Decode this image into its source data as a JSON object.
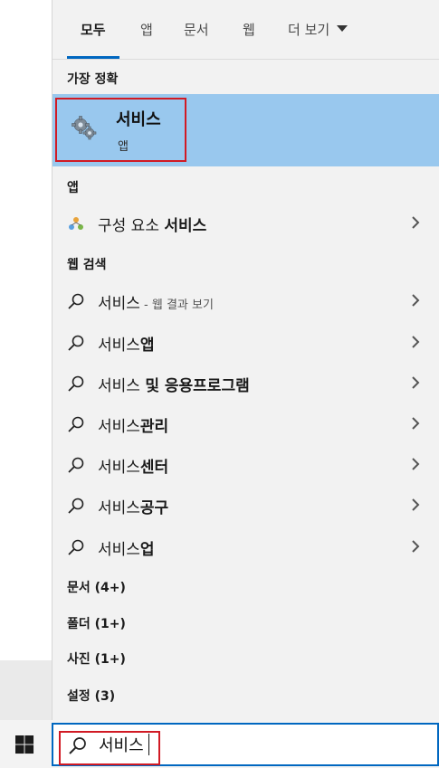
{
  "tabs": [
    {
      "label": "모두",
      "active": true
    },
    {
      "label": "앱",
      "active": false
    },
    {
      "label": "문서",
      "active": false
    },
    {
      "label": "웹",
      "active": false
    },
    {
      "label": "더 보기",
      "active": false
    }
  ],
  "best_match": {
    "heading": "가장 정확",
    "title": "서비스",
    "subtitle": "앱",
    "icon": "gears-icon"
  },
  "apps": {
    "heading": "앱",
    "items": [
      {
        "prefix": "구성 요소 ",
        "bold": "서비스",
        "icon": "component-services-icon"
      }
    ]
  },
  "web": {
    "heading": "웹 검색",
    "items": [
      {
        "prefix": "서비스",
        "bold": "",
        "hint": " - 웹 결과 보기"
      },
      {
        "prefix": "서비스",
        "bold": "앱",
        "hint": ""
      },
      {
        "prefix": "서비스 ",
        "bold": "및 응용프로그램",
        "hint": ""
      },
      {
        "prefix": "서비스",
        "bold": "관리",
        "hint": ""
      },
      {
        "prefix": "서비스",
        "bold": "센터",
        "hint": ""
      },
      {
        "prefix": "서비스",
        "bold": "공구",
        "hint": ""
      },
      {
        "prefix": "서비스",
        "bold": "업",
        "hint": ""
      }
    ]
  },
  "categories": [
    {
      "label": "문서 (4+)"
    },
    {
      "label": "폴더 (1+)"
    },
    {
      "label": "사진 (1+)"
    },
    {
      "label": "설정 (3)"
    }
  ],
  "search": {
    "value": "서비스"
  },
  "colors": {
    "accent": "#0067c0",
    "selection": "#99c8ee",
    "highlight_box": "#d11a24"
  }
}
